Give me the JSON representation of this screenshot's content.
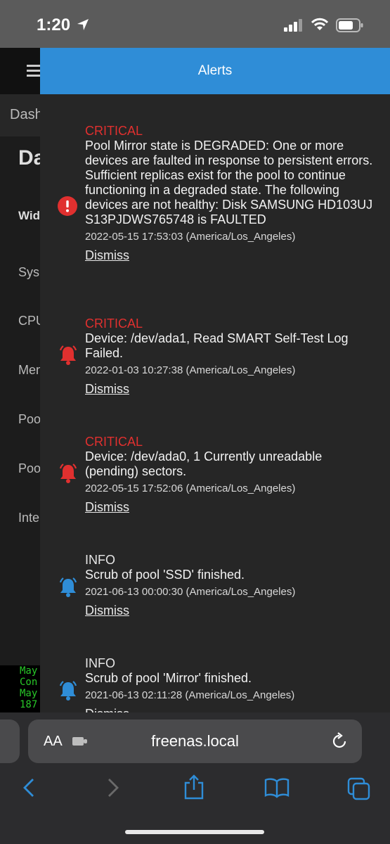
{
  "status_bar": {
    "time": "1:20"
  },
  "background": {
    "breadcrumb": "Dash",
    "title": "Da",
    "items": [
      "Wid",
      "Sys",
      "CPU",
      "Mem",
      "Poo",
      "Poo",
      "Inte"
    ],
    "console_lines": [
      "May",
      "Con",
      "May",
      "187"
    ]
  },
  "alerts_panel": {
    "title": "Alerts",
    "alerts": [
      {
        "level": "CRITICAL",
        "icon": "error-circle-icon",
        "message": "Pool Mirror state is DEGRADED: One or more devices are faulted in response to persistent errors. Sufficient replicas exist for the pool to continue functioning in a degraded state. The following devices are not healthy: Disk SAMSUNG HD103UJ S13PJDWS765748 is FAULTED",
        "timestamp": "2022-05-15 17:53:03 (America/Los_Angeles)",
        "dismiss": "Dismiss"
      },
      {
        "level": "CRITICAL",
        "icon": "bell-icon",
        "message": "Device: /dev/ada1, Read SMART Self-Test Log Failed.",
        "timestamp": "2022-01-03 10:27:38 (America/Los_Angeles)",
        "dismiss": "Dismiss"
      },
      {
        "level": "CRITICAL",
        "icon": "bell-icon",
        "message": "Device: /dev/ada0, 1 Currently unreadable (pending) sectors.",
        "timestamp": "2022-05-15 17:52:06 (America/Los_Angeles)",
        "dismiss": "Dismiss"
      },
      {
        "level": "INFO",
        "icon": "bell-icon",
        "message": "Scrub of pool 'SSD' finished.",
        "timestamp": "2021-06-13 00:00:30 (America/Los_Angeles)",
        "dismiss": "Dismiss"
      },
      {
        "level": "INFO",
        "icon": "bell-icon",
        "message": "Scrub of pool 'Mirror' finished.",
        "timestamp": "2021-06-13 02:11:28 (America/Los_Angeles)",
        "dismiss": "Dismiss"
      }
    ]
  },
  "browser": {
    "aa_label": "AA",
    "url": "freenas.local"
  },
  "colors": {
    "header": "#2f8dd7",
    "critical": "#e0302f",
    "info_icon": "#2f8dd7"
  }
}
